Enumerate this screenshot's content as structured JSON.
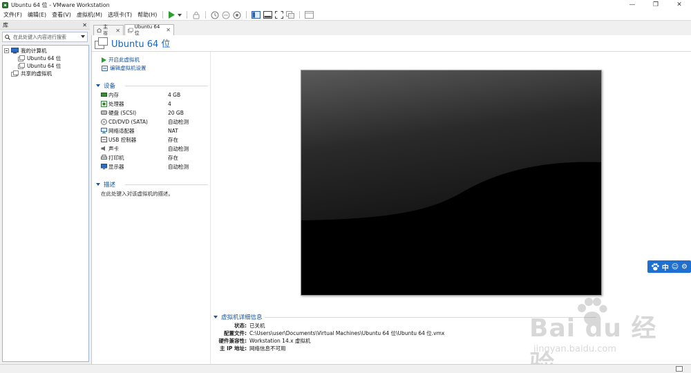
{
  "window": {
    "title": "Ubuntu 64 位 - VMware Workstation",
    "minimize": "—",
    "maximize": "❐",
    "close": "✕"
  },
  "menu": {
    "items": [
      "文件(F)",
      "编辑(E)",
      "查看(V)",
      "虚拟机(M)",
      "选项卡(T)",
      "帮助(H)"
    ]
  },
  "toolbar": {
    "icons": [
      "play-icon",
      "dropdown-icon",
      "send-keys-icon",
      "snapshot-icon",
      "revert-snapshot-icon",
      "snapshot-manager-icon",
      "library-view-icon",
      "thumbnail-bar-icon",
      "fullscreen-icon",
      "unity-icon",
      "console-view-icon"
    ]
  },
  "library": {
    "title": "库",
    "close": "✕",
    "search_placeholder": "在此处键入内容进行搜索",
    "tree": {
      "root": "我的计算机",
      "vms": [
        "Ubuntu 64 位",
        "Ubuntu 64 位"
      ],
      "shared": "共享的虚拟机"
    }
  },
  "tabs": [
    {
      "label": "主页",
      "close": "✕",
      "active": false
    },
    {
      "label": "Ubuntu 64 位",
      "close": "✕",
      "active": true
    }
  ],
  "vm": {
    "title": "Ubuntu 64 位",
    "actions": {
      "power_on": "开启此虚拟机",
      "edit_settings": "编辑虚拟机设置"
    },
    "devices_title": "设备",
    "devices": [
      {
        "name": "内存",
        "value": "4 GB",
        "icon": "memory-icon"
      },
      {
        "name": "处理器",
        "value": "4",
        "icon": "processor-icon"
      },
      {
        "name": "硬盘 (SCSI)",
        "value": "20 GB",
        "icon": "harddisk-icon"
      },
      {
        "name": "CD/DVD (SATA)",
        "value": "自动检测",
        "icon": "cdrom-icon"
      },
      {
        "name": "网络适配器",
        "value": "NAT",
        "icon": "network-icon"
      },
      {
        "name": "USB 控制器",
        "value": "存在",
        "icon": "usb-icon"
      },
      {
        "name": "声卡",
        "value": "自动检测",
        "icon": "sound-icon"
      },
      {
        "name": "打印机",
        "value": "存在",
        "icon": "printer-icon"
      },
      {
        "name": "显示器",
        "value": "自动检测",
        "icon": "display-icon"
      }
    ],
    "description_title": "描述",
    "description_text": "在此处键入对该虚拟机的描述。",
    "details_title": "虚拟机详细信息",
    "details": [
      {
        "key": "状态:",
        "value": "已关机"
      },
      {
        "key": "配置文件:",
        "value": "C:\\Users\\user\\Documents\\Virtual Machines\\Ubuntu 64 位\\Ubuntu 64 位.vmx"
      },
      {
        "key": "硬件兼容性:",
        "value": "Workstation 14.x 虚拟机"
      },
      {
        "key": "主 IP 地址:",
        "value": "网络信息不可用"
      }
    ]
  },
  "ime": {
    "lang": "中",
    "emoji": "☺",
    "settings": "⚙"
  },
  "watermark": {
    "text": "Bai du 经验",
    "url": "jingyan.baidu.com"
  },
  "colors": {
    "accent": "#1553a0",
    "title_blue": "#1565c0",
    "play_green": "#2e9e32",
    "ime_blue": "#1e6fd0"
  }
}
